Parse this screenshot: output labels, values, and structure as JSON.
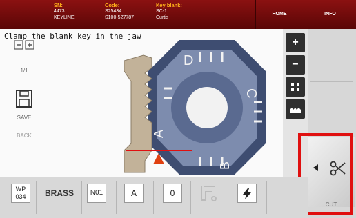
{
  "header": {
    "sn_label": "SN:",
    "sn_value1": "4473",
    "sn_value2": "KEYLINE",
    "code_label": "Code:",
    "code_value1": "S25434",
    "code_value2": "S100-527787",
    "blank_label": "Key blank:",
    "blank_value1": "SC-1",
    "blank_value2": "Curtis",
    "home": "HOME",
    "info": "INFO"
  },
  "instruction": "Clamp the blank key in the jaw",
  "jaw": {
    "letters": [
      "D",
      "C",
      "B",
      "A"
    ]
  },
  "side_tools": {
    "plus": "+",
    "minus": "−"
  },
  "right_panel": {
    "page": "1/1",
    "save": "SAVE",
    "back": "BACK",
    "cut": "CUT"
  },
  "bottom": {
    "wp": "WP\n034",
    "material": "BRASS",
    "n01": "N01",
    "a": "A",
    "zero": "0"
  },
  "colors": {
    "header": "#7a0d0d",
    "accent": "#ffb21a",
    "highlight": "#e01010"
  }
}
